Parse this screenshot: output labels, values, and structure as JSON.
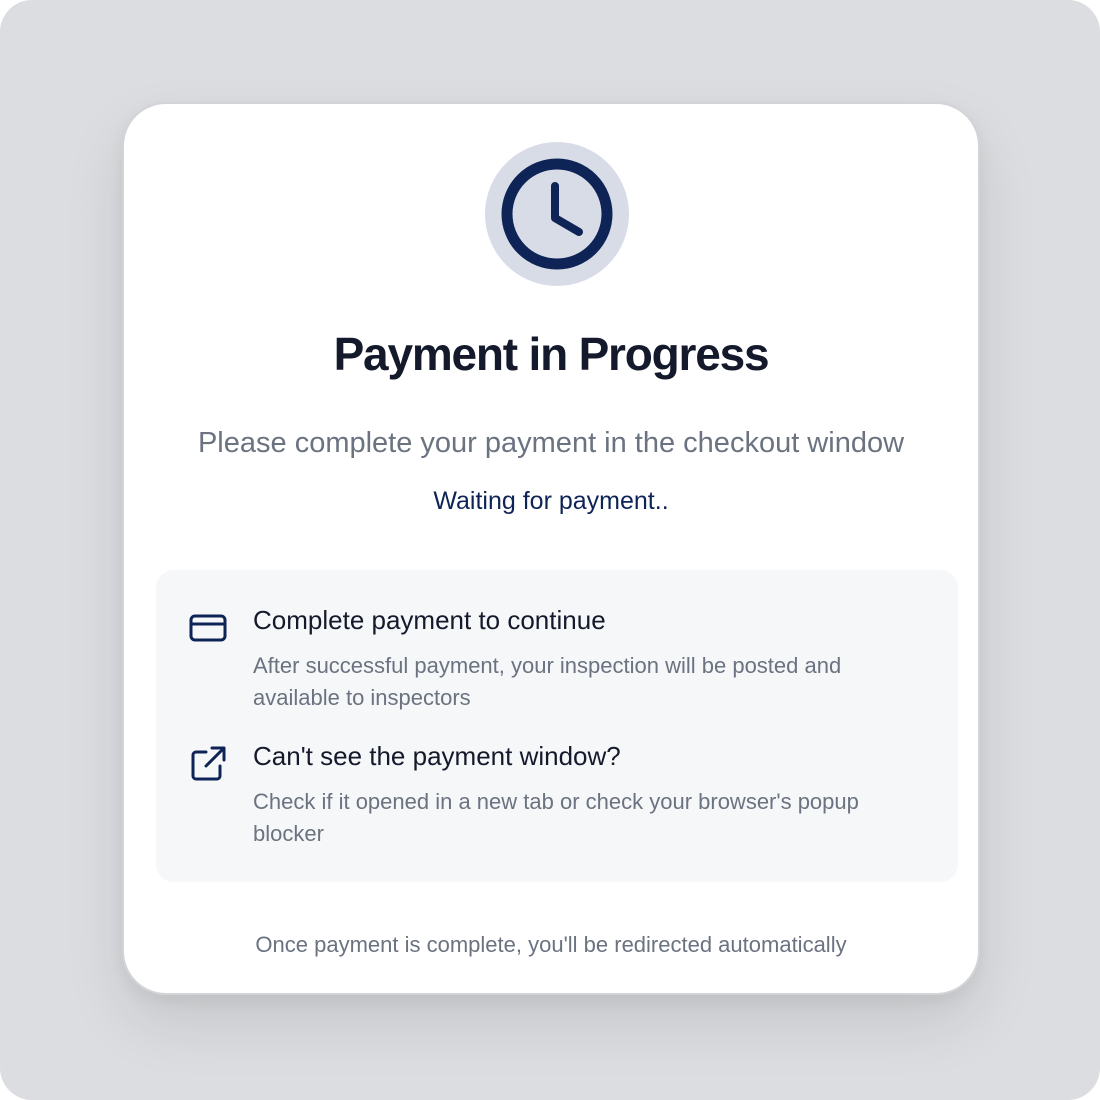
{
  "dialog": {
    "status_icon": "clock-icon",
    "title": "Payment in Progress",
    "subtitle": "Please complete your payment in the checkout window",
    "status_text": "Waiting for payment..",
    "info_items": [
      {
        "icon": "credit-card-icon",
        "heading": "Complete payment to continue",
        "description": "After successful payment, your inspection will be posted and available to inspectors"
      },
      {
        "icon": "external-link-icon",
        "heading": "Can't see the payment window?",
        "description": "Check if it opened in a new tab or check your browser's popup blocker"
      }
    ],
    "footer_note": "Once payment is complete, you'll be redirected automatically"
  },
  "colors": {
    "backdrop": "#dcdde0",
    "card_background": "#ffffff",
    "icon_badge": "#d8dce6",
    "navy_accent": "#0f2456",
    "title_text": "#141a2b",
    "muted_text": "#6b7280",
    "info_box_background": "#f6f7f9"
  }
}
